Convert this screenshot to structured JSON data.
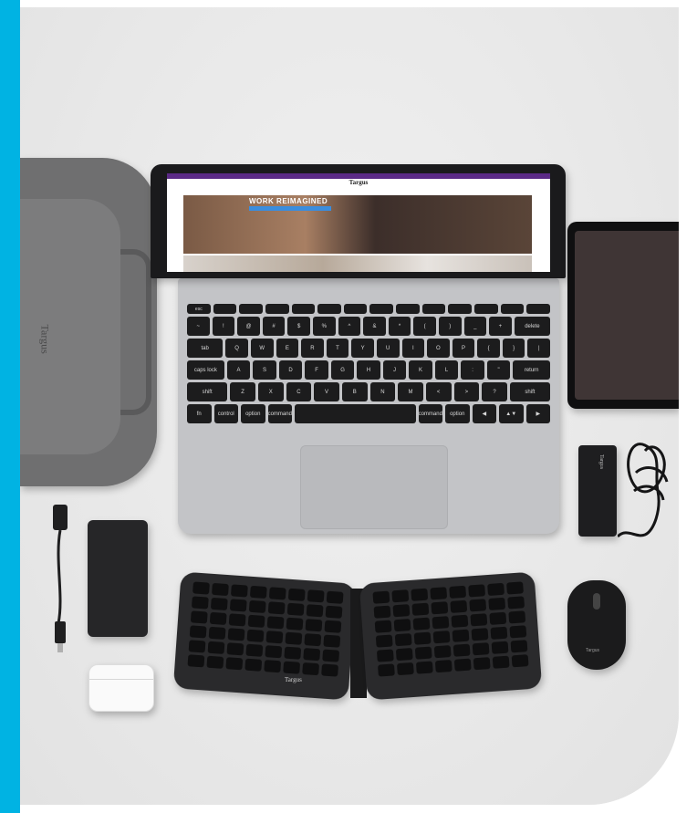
{
  "colors": {
    "accent_stripe": "#00b3e3",
    "background": "#ebebeb",
    "screen_topbar": "#5b2a86"
  },
  "backpack": {
    "logo_text": "Targus"
  },
  "laptop_screen": {
    "brand": "Targus",
    "hero_title": "WORK REIMAGINED"
  },
  "keyboard": {
    "rows": [
      [
        "esc",
        "",
        "",
        "",
        "",
        "",
        "",
        "",
        "",
        "",
        "",
        "",
        "",
        ""
      ],
      [
        "~",
        "!",
        "@",
        "#",
        "$",
        "%",
        "^",
        "&",
        "*",
        "(",
        ")",
        "_",
        "+",
        "delete"
      ],
      [
        "tab",
        "Q",
        "W",
        "E",
        "R",
        "T",
        "Y",
        "U",
        "I",
        "O",
        "P",
        "{",
        "}",
        "|"
      ],
      [
        "caps lock",
        "A",
        "S",
        "D",
        "F",
        "G",
        "H",
        "J",
        "K",
        "L",
        ":",
        "\"",
        "return"
      ],
      [
        "shift",
        "Z",
        "X",
        "C",
        "V",
        "B",
        "N",
        "M",
        "<",
        ">",
        "?",
        "shift"
      ],
      [
        "fn",
        "control",
        "option",
        "command",
        "",
        "command",
        "option",
        "◀",
        "▲▼",
        "▶"
      ]
    ]
  },
  "folding_keyboard": {
    "logo_text": "Targus"
  },
  "charger": {
    "logo_text": "Targus"
  },
  "mouse": {
    "logo_text": "Targus"
  }
}
